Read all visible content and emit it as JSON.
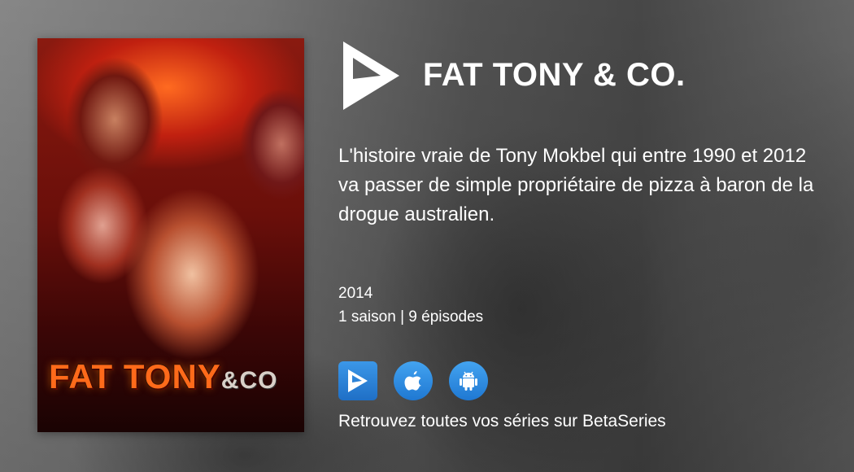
{
  "poster": {
    "title_main": "FAT TONY",
    "title_amp": "&CO"
  },
  "show": {
    "title": "FAT TONY & CO.",
    "description": "L'histoire vraie de Tony Mokbel qui entre 1990 et 2012 va passer de simple propriétaire de pizza à baron de la drogue australien.",
    "year": "2014",
    "seasons": "1 saison",
    "separator": "|",
    "episodes": "9 épisodes"
  },
  "apps": [
    {
      "name": "betaseries",
      "icon": "betaseries-play-icon"
    },
    {
      "name": "ios",
      "icon": "apple-icon"
    },
    {
      "name": "android",
      "icon": "android-icon"
    }
  ],
  "footer": {
    "tagline": "Retrouvez toutes vos séries sur BetaSeries"
  },
  "colors": {
    "text": "#ffffff",
    "app_blue": "#2b86dc",
    "poster_title": "#ff6a1a"
  }
}
